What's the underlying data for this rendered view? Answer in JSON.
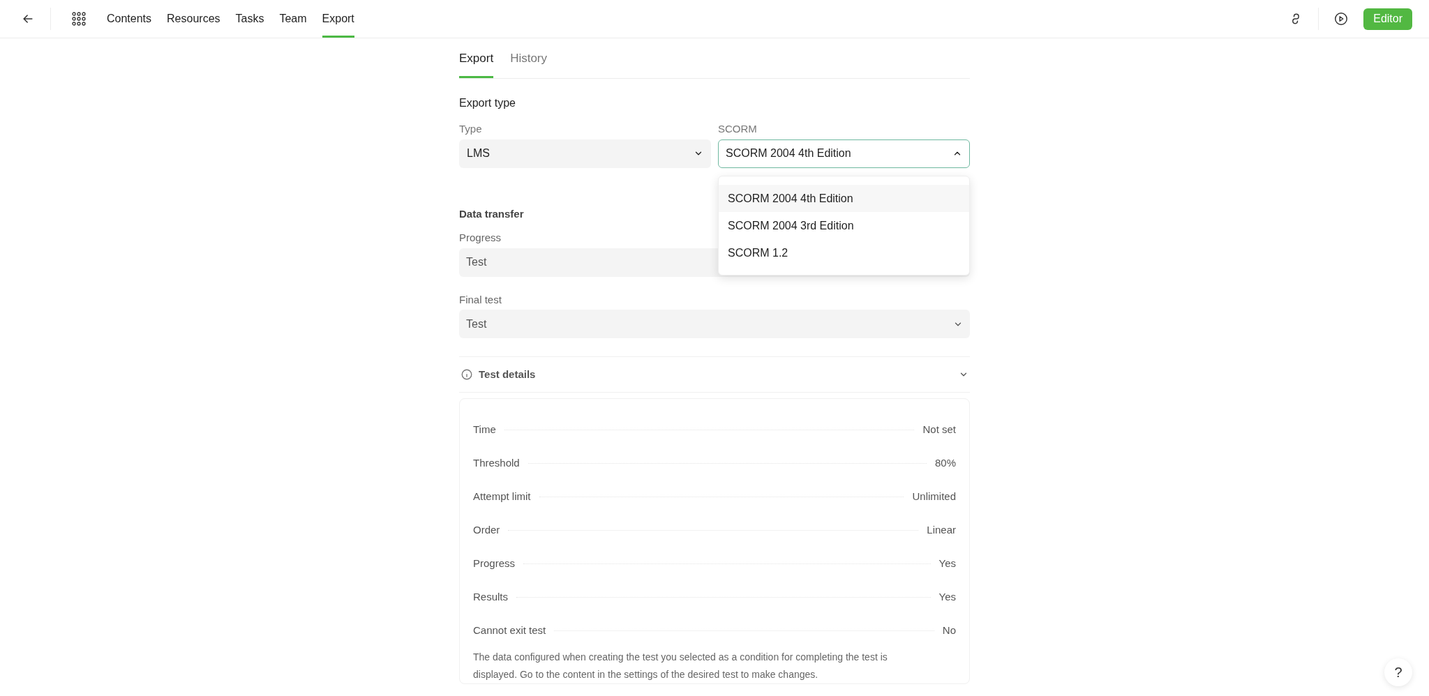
{
  "nav": {
    "items": [
      {
        "label": "Contents",
        "selected": false
      },
      {
        "label": "Resources",
        "selected": false
      },
      {
        "label": "Tasks",
        "selected": false
      },
      {
        "label": "Team",
        "selected": false
      },
      {
        "label": "Export",
        "selected": true
      }
    ],
    "editor_button": "Editor"
  },
  "tabs": [
    {
      "label": "Export",
      "selected": true
    },
    {
      "label": "History",
      "selected": false
    }
  ],
  "export_type": {
    "heading": "Export type",
    "type_field": {
      "label": "Type",
      "value": "LMS",
      "expanded": false
    },
    "scorm_field": {
      "label": "SCORM",
      "value": "SCORM 2004 4th Edition",
      "expanded": true
    },
    "scorm_options": [
      {
        "label": "SCORM 2004 4th Edition",
        "selected": true
      },
      {
        "label": "SCORM 2004 3rd Edition",
        "selected": false
      },
      {
        "label": "SCORM 1.2",
        "selected": false
      }
    ]
  },
  "data_transfer": {
    "heading": "Data transfer",
    "fields": [
      {
        "label": "Progress",
        "value": "Test"
      },
      {
        "label": "Final test",
        "value": "Test"
      }
    ]
  },
  "test_details": {
    "title": "Test details",
    "rows": [
      {
        "label": "Time",
        "value": "Not set"
      },
      {
        "label": "Threshold",
        "value": "80%"
      },
      {
        "label": "Attempt limit",
        "value": "Unlimited"
      },
      {
        "label": "Order",
        "value": "Linear"
      },
      {
        "label": "Progress",
        "value": "Yes"
      },
      {
        "label": "Results",
        "value": "Yes"
      },
      {
        "label": "Cannot exit test",
        "value": "No"
      }
    ],
    "note": "The data configured when creating the test you selected as a condition for completing the test is displayed. Go to the content in the settings of the desired test to make changes."
  },
  "help_button": "?"
}
